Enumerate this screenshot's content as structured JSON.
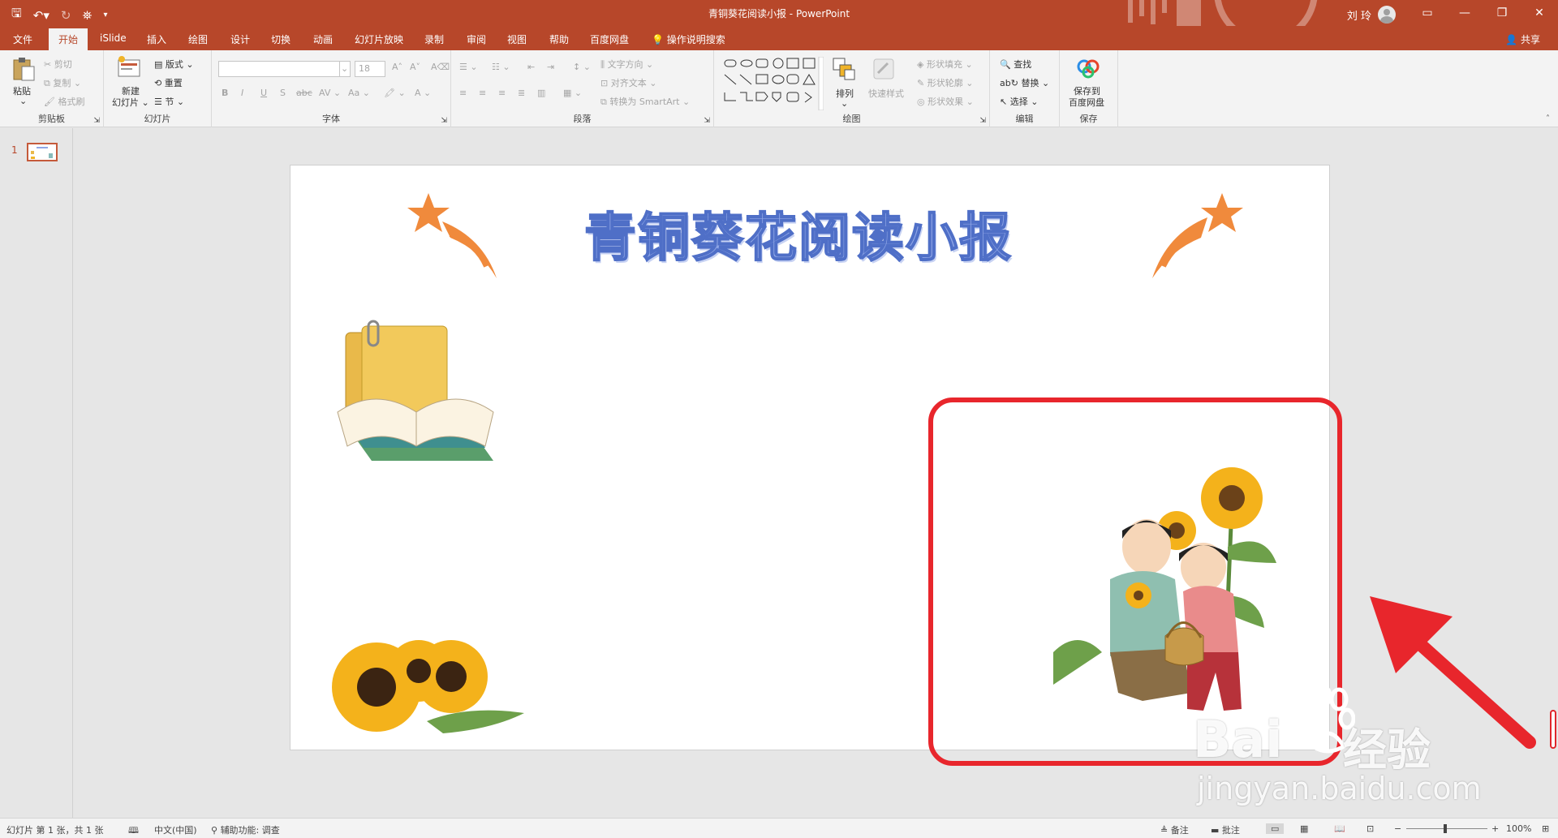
{
  "titlebar": {
    "document": "青铜葵花阅读小报",
    "app": "PowerPoint",
    "separator": "-",
    "user": "刘 玲"
  },
  "tabs": [
    "文件",
    "开始",
    "iSlide",
    "插入",
    "绘图",
    "设计",
    "切换",
    "动画",
    "幻灯片放映",
    "录制",
    "审阅",
    "视图",
    "帮助",
    "百度网盘"
  ],
  "active_tab": "开始",
  "tell_me": "操作说明搜索",
  "share": "共享",
  "ribbon": {
    "clipboard": {
      "label": "剪贴板",
      "paste": "粘贴",
      "cut": "剪切",
      "copy": "复制",
      "format_painter": "格式刷"
    },
    "slides": {
      "label": "幻灯片",
      "new_slide_line1": "新建",
      "new_slide_line2": "幻灯片",
      "layout": "版式",
      "reset": "重置",
      "section": "节"
    },
    "font": {
      "label": "字体",
      "font_name": "",
      "font_size": "18"
    },
    "paragraph": {
      "label": "段落",
      "text_direction": "文字方向",
      "align_text": "对齐文本",
      "smartart": "转换为 SmartArt"
    },
    "drawing": {
      "label": "绘图",
      "arrange": "排列",
      "quick_styles": "快速样式",
      "shape_fill": "形状填充",
      "shape_outline": "形状轮廓",
      "shape_effects": "形状效果"
    },
    "editing": {
      "label": "编辑",
      "find": "查找",
      "replace": "替换",
      "select": "选择"
    },
    "save": {
      "label": "保存",
      "save_line1": "保存到",
      "save_line2": "百度网盘"
    }
  },
  "thumbnails": [
    {
      "number": "1"
    }
  ],
  "slide": {
    "title": "青铜葵花阅读小报"
  },
  "watermark": {
    "brand": "Bai",
    "brand2": "经验",
    "url": "jingyan.baidu.com"
  },
  "statusbar": {
    "slide_info": "幻灯片 第 1 张，共 1 张",
    "language": "中文(中国)",
    "accessibility": "辅助功能: 调查",
    "notes": "备注",
    "comments": "批注",
    "zoom": "100%"
  },
  "colors": {
    "accent": "#b7472a",
    "annotation": "#e8262c",
    "title_fill": "#8fa6e6",
    "title_stroke": "#4f6fc7"
  }
}
